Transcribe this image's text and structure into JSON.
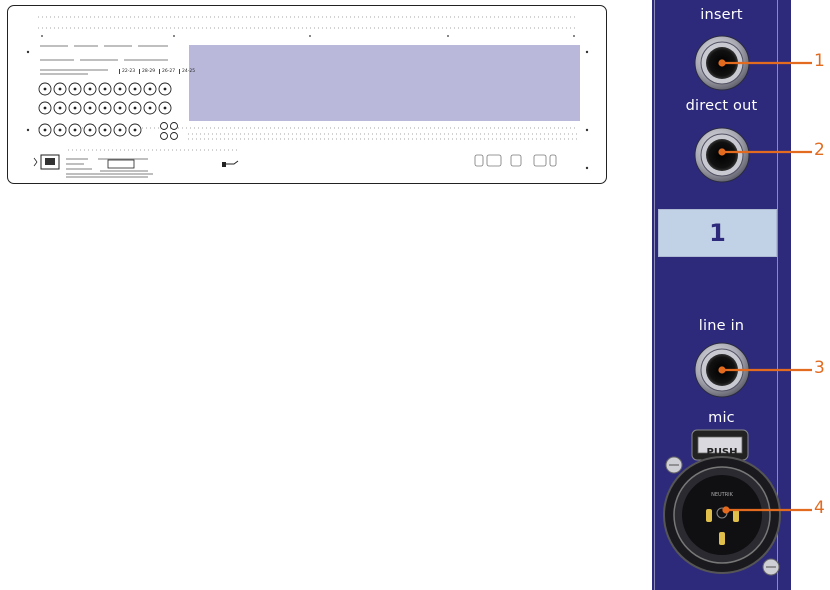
{
  "overview": {
    "group_labels": [
      "22-23",
      "28-29",
      "26-27",
      "24-25"
    ]
  },
  "strip": {
    "labels": {
      "insert": "insert",
      "direct_out": "direct out",
      "channel_number": "1",
      "line_in": "line in",
      "mic": "mic",
      "push": "PUSH",
      "neutrik": "NEUTRIK"
    }
  },
  "callouts": [
    "1",
    "2",
    "3",
    "4"
  ],
  "colors": {
    "strip_background": "#2d2a7c",
    "highlight": "#b9b8da",
    "callout": "#e36b1f",
    "display": "#c2d2e6"
  }
}
